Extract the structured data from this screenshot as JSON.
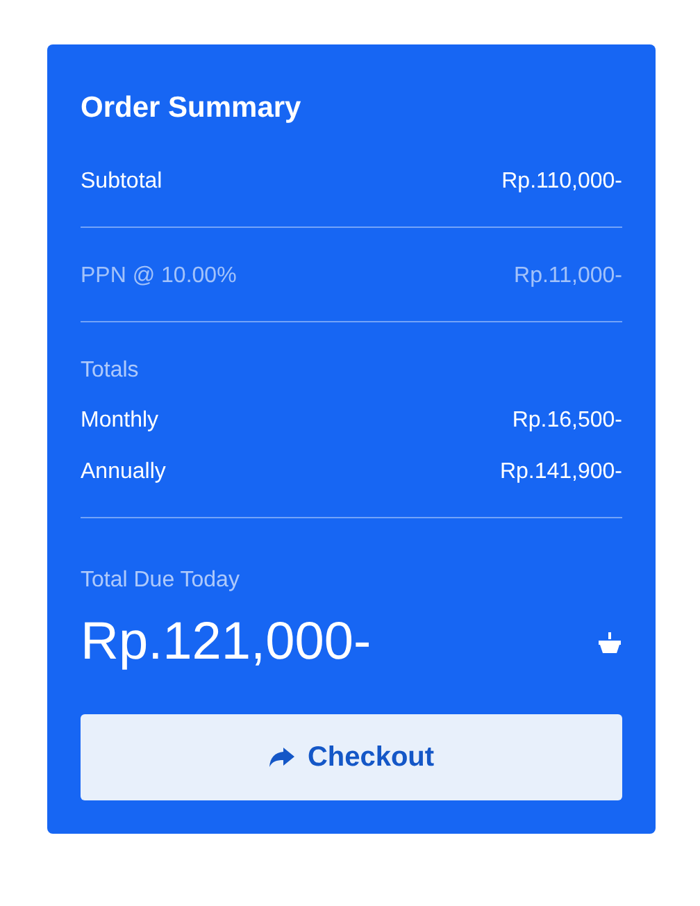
{
  "title": "Order Summary",
  "sections": [
    {
      "rows": [
        {
          "label": "Subtotal",
          "value": "Rp.110,000-",
          "muted": false
        }
      ]
    },
    {
      "rows": [
        {
          "label": "PPN @ 10.00%",
          "value": "Rp.11,000-",
          "muted": true
        }
      ]
    },
    {
      "heading": "Totals",
      "rows": [
        {
          "label": "Monthly",
          "value": "Rp.16,500-",
          "muted": false
        },
        {
          "label": "Annually",
          "value": "Rp.141,900-",
          "muted": false
        }
      ]
    }
  ],
  "due": {
    "label": "Total Due Today",
    "amount": "Rp.121,000-"
  },
  "checkout": {
    "label": "Checkout"
  }
}
